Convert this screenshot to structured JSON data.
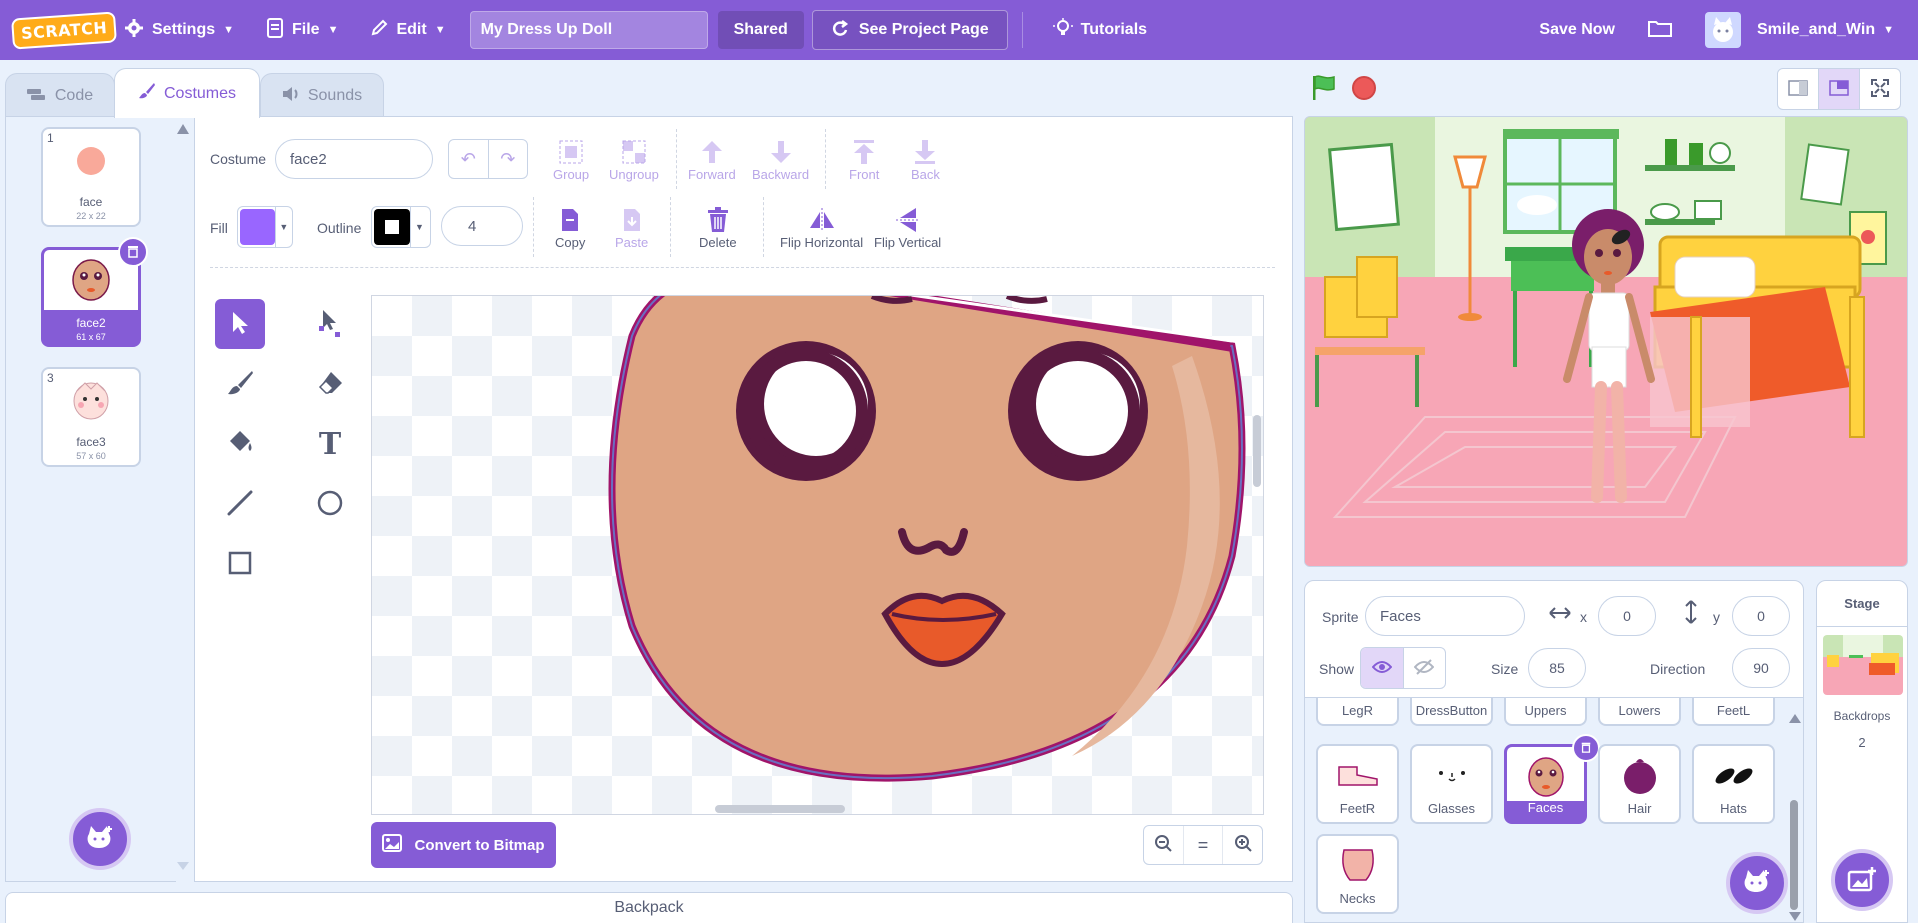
{
  "menubar": {
    "logo": "SCRATCH",
    "settings": "Settings",
    "file": "File",
    "edit": "Edit",
    "project_title": "My Dress Up Doll",
    "shared": "Shared",
    "see_project_page": "See Project Page",
    "tutorials": "Tutorials",
    "save_now": "Save Now",
    "username": "Smile_and_Win"
  },
  "tabs": {
    "code": "Code",
    "costumes": "Costumes",
    "sounds": "Sounds"
  },
  "costumes": [
    {
      "num": "1",
      "name": "face",
      "size": "22 x 22"
    },
    {
      "num": "2",
      "name": "face2",
      "size": "61 x 67"
    },
    {
      "num": "3",
      "name": "face3",
      "size": "57 x 60"
    }
  ],
  "paint": {
    "costume_label": "Costume",
    "costume_name": "face2",
    "group": "Group",
    "ungroup": "Ungroup",
    "forward": "Forward",
    "backward": "Backward",
    "front": "Front",
    "back": "Back",
    "fill_label": "Fill",
    "outline_label": "Outline",
    "outline_width": "4",
    "copy": "Copy",
    "paste": "Paste",
    "delete": "Delete",
    "flip_horizontal": "Flip Horizontal",
    "flip_vertical": "Flip Vertical",
    "convert": "Convert to Bitmap",
    "fill_color": "#9966ff",
    "outline_color": "#000000"
  },
  "backpack": "Backpack",
  "sprite_info": {
    "sprite_label": "Sprite",
    "sprite_name": "Faces",
    "x_label": "x",
    "x_value": "0",
    "y_label": "y",
    "y_value": "0",
    "show_label": "Show",
    "size_label": "Size",
    "size_value": "85",
    "direction_label": "Direction",
    "direction_value": "90"
  },
  "sprites_row0": [
    "LegR",
    "DressButton",
    "Uppers",
    "Lowers",
    "FeetL"
  ],
  "sprites_row1": [
    "FeetR",
    "Glasses",
    "Faces",
    "Hair",
    "Hats"
  ],
  "sprites_row2": [
    "Necks"
  ],
  "stage_panel": {
    "title": "Stage",
    "backdrops_label": "Backdrops",
    "backdrops_count": "2"
  },
  "colors": {
    "accent": "#855cd6",
    "background": "#e9f1fc"
  }
}
